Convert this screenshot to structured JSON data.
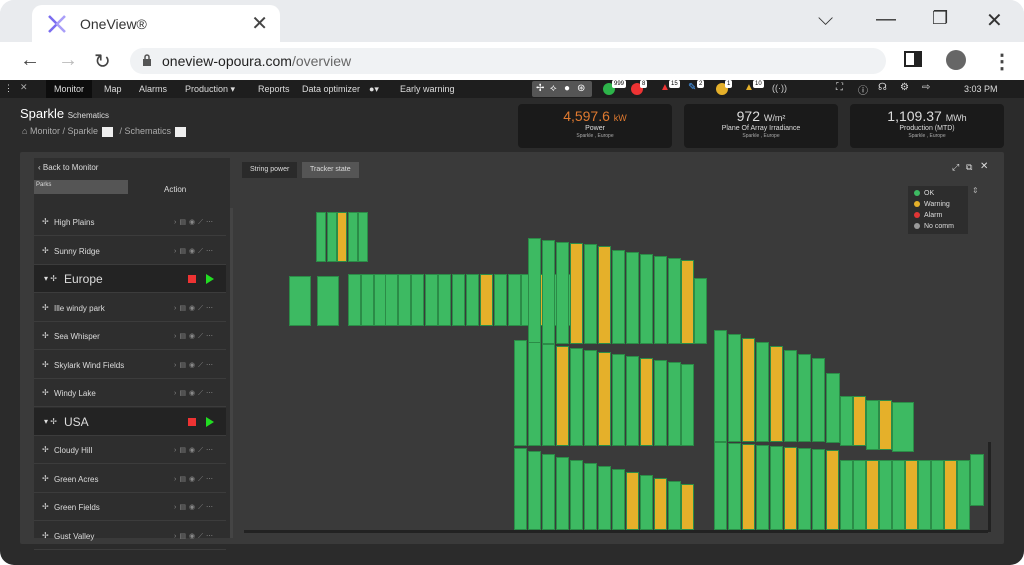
{
  "browser": {
    "tab_title": "OneView®",
    "url_host": "oneview-opoura.com",
    "url_path": "/overview"
  },
  "nav": {
    "monitor": "Monitor",
    "map": "Map",
    "alarms": "Alarms",
    "production": "Production ▾",
    "reports": "Reports",
    "data_optimizer": "Data optimizer",
    "early_warning": "Early warning",
    "time": "3:03 PM",
    "badges": [
      "999",
      "8",
      "15",
      "2",
      "1",
      "10"
    ]
  },
  "header": {
    "plant_name": "Sparkle",
    "plant_sub": "Schematics",
    "crumb_1": "Monitor",
    "crumb_2": "/ Sparkle",
    "crumb_3": "/ Schematics"
  },
  "kpis": [
    {
      "value": "4,597.6",
      "unit": "kW",
      "label": "Power",
      "sub": "Sparkle , Europe",
      "color": "#e07a30"
    },
    {
      "value": "972",
      "unit": "W/m²",
      "label": "Plane Of Array Irradiance",
      "sub": "Sparkle , Europe",
      "color": "#dddddd"
    },
    {
      "value": "1,109.37",
      "unit": "MWh",
      "label": "Production (MTD)",
      "sub": "Sparkle , Europe",
      "color": "#dddddd"
    }
  ],
  "sidebar": {
    "back": "Back to Monitor",
    "search_placeholder": "Parks",
    "action_header": "Action",
    "rows": [
      {
        "label": "High Plains",
        "type": "site"
      },
      {
        "label": "Sunny Ridge",
        "type": "site"
      },
      {
        "label": "Europe",
        "type": "group"
      },
      {
        "label": "Ille windy park",
        "type": "site"
      },
      {
        "label": "Sea Whisper",
        "type": "site"
      },
      {
        "label": "Skylark Wind Fields",
        "type": "site"
      },
      {
        "label": "Windy Lake",
        "type": "site"
      },
      {
        "label": "USA",
        "type": "group"
      },
      {
        "label": "Cloudy Hill",
        "type": "site"
      },
      {
        "label": "Green Acres",
        "type": "site"
      },
      {
        "label": "Green Fields",
        "type": "site"
      },
      {
        "label": "Gust Valley",
        "type": "site"
      }
    ]
  },
  "view_tabs": {
    "string_power": "String power",
    "tracker_state": "Tracker state"
  },
  "legend": [
    {
      "label": "OK",
      "color": "#3dba62"
    },
    {
      "label": "Warning",
      "color": "#e5b02a"
    },
    {
      "label": "Alarm",
      "color": "#e03535"
    },
    {
      "label": "No comm",
      "color": "#9a9a9a"
    }
  ],
  "colors": {
    "ok": "#3dba62",
    "warning": "#e5b02a"
  }
}
